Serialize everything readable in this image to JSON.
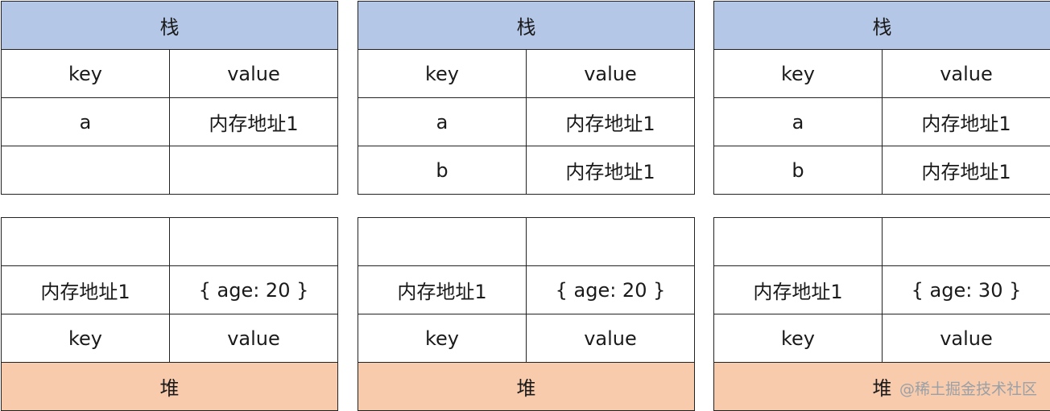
{
  "panels": [
    {
      "stack": {
        "title": "栈",
        "header": [
          "key",
          "value"
        ],
        "rows": [
          [
            "a",
            "内存地址1"
          ],
          [
            "",
            ""
          ]
        ]
      },
      "heap": {
        "title": "堆",
        "header": [
          "key",
          "value"
        ],
        "rows": [
          [
            "",
            ""
          ],
          [
            "内存地址1",
            "{ age: 20 }"
          ]
        ]
      }
    },
    {
      "stack": {
        "title": "栈",
        "header": [
          "key",
          "value"
        ],
        "rows": [
          [
            "a",
            "内存地址1"
          ],
          [
            "b",
            "内存地址1"
          ]
        ]
      },
      "heap": {
        "title": "堆",
        "header": [
          "key",
          "value"
        ],
        "rows": [
          [
            "",
            ""
          ],
          [
            "内存地址1",
            "{ age: 20 }"
          ]
        ]
      }
    },
    {
      "stack": {
        "title": "栈",
        "header": [
          "key",
          "value"
        ],
        "rows": [
          [
            "a",
            "内存地址1"
          ],
          [
            "b",
            "内存地址1"
          ]
        ]
      },
      "heap": {
        "title": "堆",
        "header": [
          "key",
          "value"
        ],
        "rows": [
          [
            "",
            ""
          ],
          [
            "内存地址1",
            "{ age: 30 }"
          ]
        ]
      }
    }
  ],
  "watermark": "@稀土掘金技术社区",
  "colors": {
    "stack_header": "#b4c7e7",
    "heap_footer": "#f8cbad",
    "border": "#222222"
  }
}
